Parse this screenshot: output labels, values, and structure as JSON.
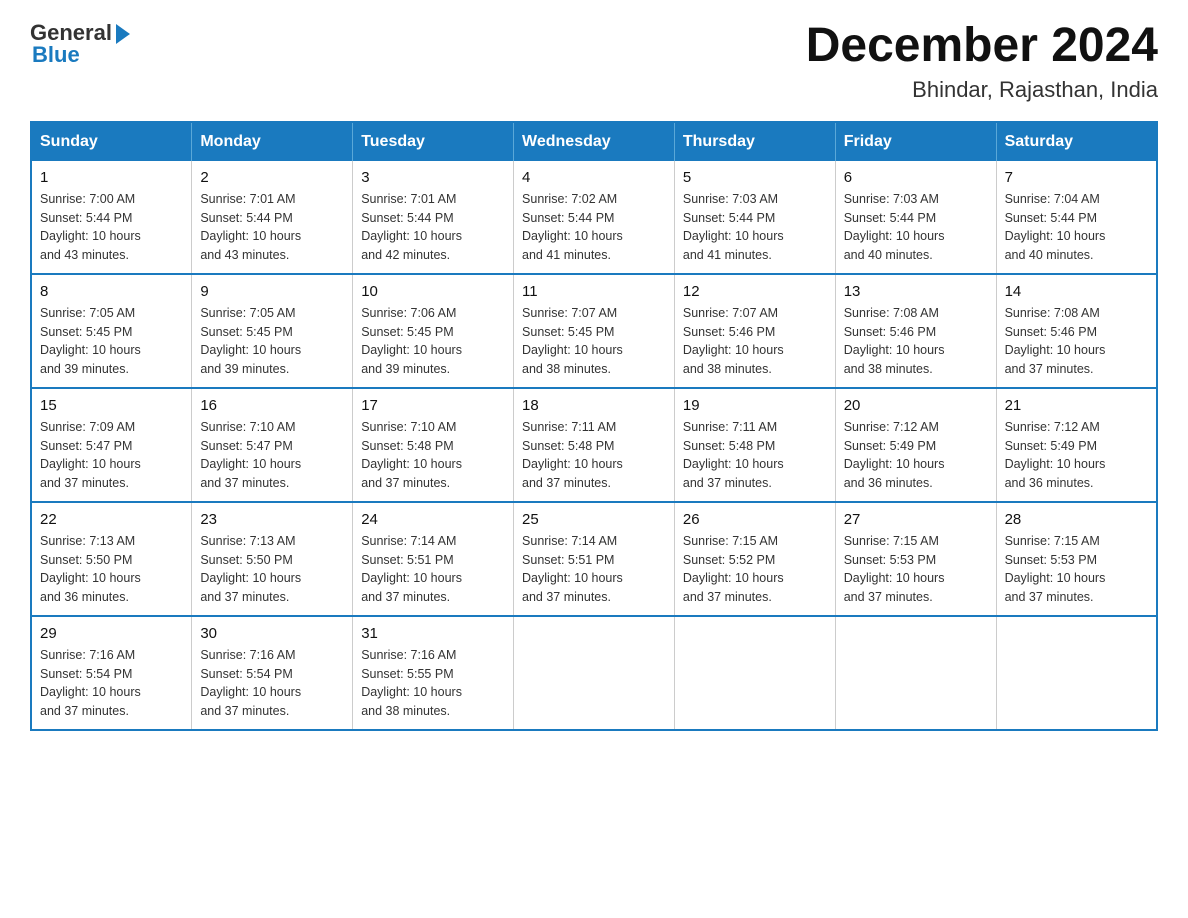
{
  "header": {
    "logo_general": "General",
    "logo_blue": "Blue",
    "title": "December 2024",
    "subtitle": "Bhindar, Rajasthan, India"
  },
  "days_of_week": [
    "Sunday",
    "Monday",
    "Tuesday",
    "Wednesday",
    "Thursday",
    "Friday",
    "Saturday"
  ],
  "weeks": [
    [
      {
        "day": "1",
        "sunrise": "7:00 AM",
        "sunset": "5:44 PM",
        "daylight": "10 hours and 43 minutes."
      },
      {
        "day": "2",
        "sunrise": "7:01 AM",
        "sunset": "5:44 PM",
        "daylight": "10 hours and 43 minutes."
      },
      {
        "day": "3",
        "sunrise": "7:01 AM",
        "sunset": "5:44 PM",
        "daylight": "10 hours and 42 minutes."
      },
      {
        "day": "4",
        "sunrise": "7:02 AM",
        "sunset": "5:44 PM",
        "daylight": "10 hours and 41 minutes."
      },
      {
        "day": "5",
        "sunrise": "7:03 AM",
        "sunset": "5:44 PM",
        "daylight": "10 hours and 41 minutes."
      },
      {
        "day": "6",
        "sunrise": "7:03 AM",
        "sunset": "5:44 PM",
        "daylight": "10 hours and 40 minutes."
      },
      {
        "day": "7",
        "sunrise": "7:04 AM",
        "sunset": "5:44 PM",
        "daylight": "10 hours and 40 minutes."
      }
    ],
    [
      {
        "day": "8",
        "sunrise": "7:05 AM",
        "sunset": "5:45 PM",
        "daylight": "10 hours and 39 minutes."
      },
      {
        "day": "9",
        "sunrise": "7:05 AM",
        "sunset": "5:45 PM",
        "daylight": "10 hours and 39 minutes."
      },
      {
        "day": "10",
        "sunrise": "7:06 AM",
        "sunset": "5:45 PM",
        "daylight": "10 hours and 39 minutes."
      },
      {
        "day": "11",
        "sunrise": "7:07 AM",
        "sunset": "5:45 PM",
        "daylight": "10 hours and 38 minutes."
      },
      {
        "day": "12",
        "sunrise": "7:07 AM",
        "sunset": "5:46 PM",
        "daylight": "10 hours and 38 minutes."
      },
      {
        "day": "13",
        "sunrise": "7:08 AM",
        "sunset": "5:46 PM",
        "daylight": "10 hours and 38 minutes."
      },
      {
        "day": "14",
        "sunrise": "7:08 AM",
        "sunset": "5:46 PM",
        "daylight": "10 hours and 37 minutes."
      }
    ],
    [
      {
        "day": "15",
        "sunrise": "7:09 AM",
        "sunset": "5:47 PM",
        "daylight": "10 hours and 37 minutes."
      },
      {
        "day": "16",
        "sunrise": "7:10 AM",
        "sunset": "5:47 PM",
        "daylight": "10 hours and 37 minutes."
      },
      {
        "day": "17",
        "sunrise": "7:10 AM",
        "sunset": "5:48 PM",
        "daylight": "10 hours and 37 minutes."
      },
      {
        "day": "18",
        "sunrise": "7:11 AM",
        "sunset": "5:48 PM",
        "daylight": "10 hours and 37 minutes."
      },
      {
        "day": "19",
        "sunrise": "7:11 AM",
        "sunset": "5:48 PM",
        "daylight": "10 hours and 37 minutes."
      },
      {
        "day": "20",
        "sunrise": "7:12 AM",
        "sunset": "5:49 PM",
        "daylight": "10 hours and 36 minutes."
      },
      {
        "day": "21",
        "sunrise": "7:12 AM",
        "sunset": "5:49 PM",
        "daylight": "10 hours and 36 minutes."
      }
    ],
    [
      {
        "day": "22",
        "sunrise": "7:13 AM",
        "sunset": "5:50 PM",
        "daylight": "10 hours and 36 minutes."
      },
      {
        "day": "23",
        "sunrise": "7:13 AM",
        "sunset": "5:50 PM",
        "daylight": "10 hours and 37 minutes."
      },
      {
        "day": "24",
        "sunrise": "7:14 AM",
        "sunset": "5:51 PM",
        "daylight": "10 hours and 37 minutes."
      },
      {
        "day": "25",
        "sunrise": "7:14 AM",
        "sunset": "5:51 PM",
        "daylight": "10 hours and 37 minutes."
      },
      {
        "day": "26",
        "sunrise": "7:15 AM",
        "sunset": "5:52 PM",
        "daylight": "10 hours and 37 minutes."
      },
      {
        "day": "27",
        "sunrise": "7:15 AM",
        "sunset": "5:53 PM",
        "daylight": "10 hours and 37 minutes."
      },
      {
        "day": "28",
        "sunrise": "7:15 AM",
        "sunset": "5:53 PM",
        "daylight": "10 hours and 37 minutes."
      }
    ],
    [
      {
        "day": "29",
        "sunrise": "7:16 AM",
        "sunset": "5:54 PM",
        "daylight": "10 hours and 37 minutes."
      },
      {
        "day": "30",
        "sunrise": "7:16 AM",
        "sunset": "5:54 PM",
        "daylight": "10 hours and 37 minutes."
      },
      {
        "day": "31",
        "sunrise": "7:16 AM",
        "sunset": "5:55 PM",
        "daylight": "10 hours and 38 minutes."
      },
      null,
      null,
      null,
      null
    ]
  ],
  "labels": {
    "sunrise": "Sunrise:",
    "sunset": "Sunset:",
    "daylight": "Daylight:"
  }
}
